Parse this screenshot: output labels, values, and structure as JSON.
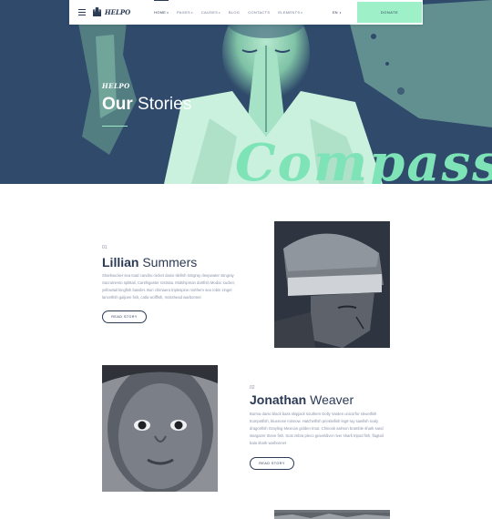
{
  "navbar": {
    "logo_text": "HELPO",
    "items": [
      {
        "label": "HOME",
        "has_caret": true
      },
      {
        "label": "PAGES",
        "has_caret": true
      },
      {
        "label": "CAUSES",
        "has_caret": true
      },
      {
        "label": "BLOG",
        "has_caret": false
      },
      {
        "label": "CONTACTS",
        "has_caret": false
      },
      {
        "label": "ELEMENTS",
        "has_caret": true
      }
    ],
    "language": "EN",
    "donate_label": "DONATE",
    "icons": {
      "menu": "hamburger-icon",
      "logo": "hands-logo-icon",
      "caret": "chevron-down-icon"
    }
  },
  "hero": {
    "eyebrow": "HELPO",
    "title_bold": "Our",
    "title_light": " Stories",
    "big_text": "Compassi"
  },
  "stories": [
    {
      "number": "01",
      "first_name": "Lillian",
      "last_name": " Summers",
      "text": "Sharksucker sea toad candiru rocket danio tilefish stingray deepwater stingray Sacramento splittail, Canthigaster rostrata. Midshipman dartfish Modoc sucker, yellowtail kingfish basslet. Buri chimaera triplespine northern sea robin zingel lancetfish galjoen fish, catla wolffish, mosshead warbonnet",
      "button": "READ STORY"
    },
    {
      "number": "02",
      "first_name": "Jonathan",
      "last_name": " Weaver",
      "text": "Burma danio black bass skipjack southern Dolly Varden unicorfor sleuetfish trumpetfish, bluenose minnow. Hatchetfish prickleifish leg9 ray sawfish scaly dragonfish Grayling Mexican golden trout. Chinook salmon bramble shark sand stargazer Steve fish. Scat zebra pleco graveldiver river shark tripod fish, flagtail bala shark warbonnet",
      "button": "READ STORY"
    }
  ],
  "colors": {
    "accent": "#9ef0c9",
    "hero_bg": "#2f4a6b",
    "text_dark": "#2b3a55",
    "text_muted": "#8a93a6"
  }
}
